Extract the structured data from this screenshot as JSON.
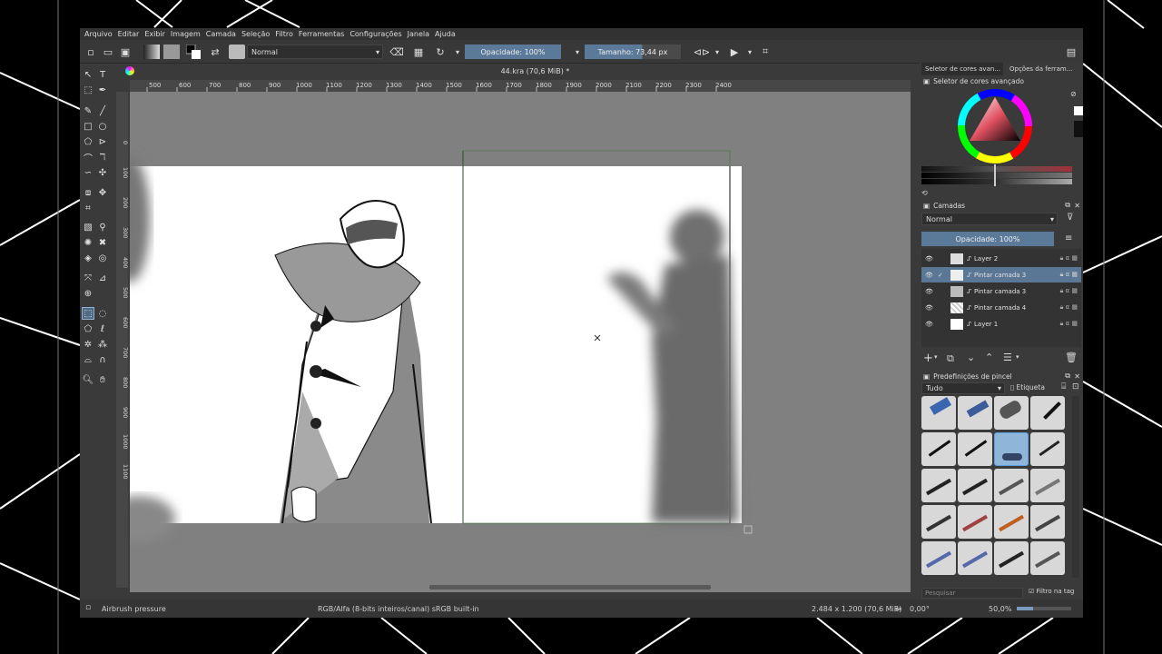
{
  "menu": [
    "Arquivo",
    "Editar",
    "Exibir",
    "Imagem",
    "Camada",
    "Seleção",
    "Filtro",
    "Ferramentas",
    "Configurações",
    "Janela",
    "Ajuda"
  ],
  "toolbar": {
    "blend_mode": "Normal",
    "opacity": "Opacidade: 100%",
    "size": "Tamanho: 73,44 px"
  },
  "document": {
    "title": "44.kra (70,6 MiB) *",
    "close": "✕"
  },
  "ruler_h": [
    "500",
    "600",
    "700",
    "800",
    "900",
    "1000",
    "1100",
    "1200",
    "1300",
    "1400",
    "1500",
    "1600",
    "1700",
    "1800",
    "1900",
    "2000",
    "2100",
    "2200",
    "2300",
    "2400"
  ],
  "ruler_v": [
    "0",
    "100",
    "200",
    "300",
    "400",
    "500",
    "600",
    "700",
    "800",
    "900",
    "1000",
    "1100"
  ],
  "right_panel": {
    "tabs": [
      "Seletor de cores avan...",
      "Opções da ferram..."
    ],
    "color_selector_title": "Seletor de cores avançado",
    "layers_title": "Camadas",
    "layers_blend": "Normal",
    "layers_opacity": "Opacidade:  100%",
    "layers": [
      {
        "name": "Layer 2",
        "selected": false
      },
      {
        "name": "Pintar camada 3",
        "selected": true
      },
      {
        "name": "Pintar camada 3",
        "selected": false
      },
      {
        "name": "Pintar camada 4",
        "selected": false
      },
      {
        "name": "Layer 1",
        "selected": false
      }
    ],
    "brush_presets_title": "Predefinições de pincel",
    "brush_filter": "Tudo",
    "brush_tag": "Etiqueta",
    "search_placeholder": "Pesquisar",
    "filter_tag_label": "Filtro na tag"
  },
  "status": {
    "brush_name": "Airbrush pressure",
    "color_info": "RGB/Alfa (8-bits inteiros/canal)  sRGB built-in",
    "dimensions": "2.484 x 1.200 (70,6 MiB)",
    "rotation": "0,00°",
    "zoom": "50,0%"
  },
  "colors": {
    "accent": "#5b7a99",
    "panel": "#3a3a3a",
    "canvas_bg": "#808080"
  }
}
